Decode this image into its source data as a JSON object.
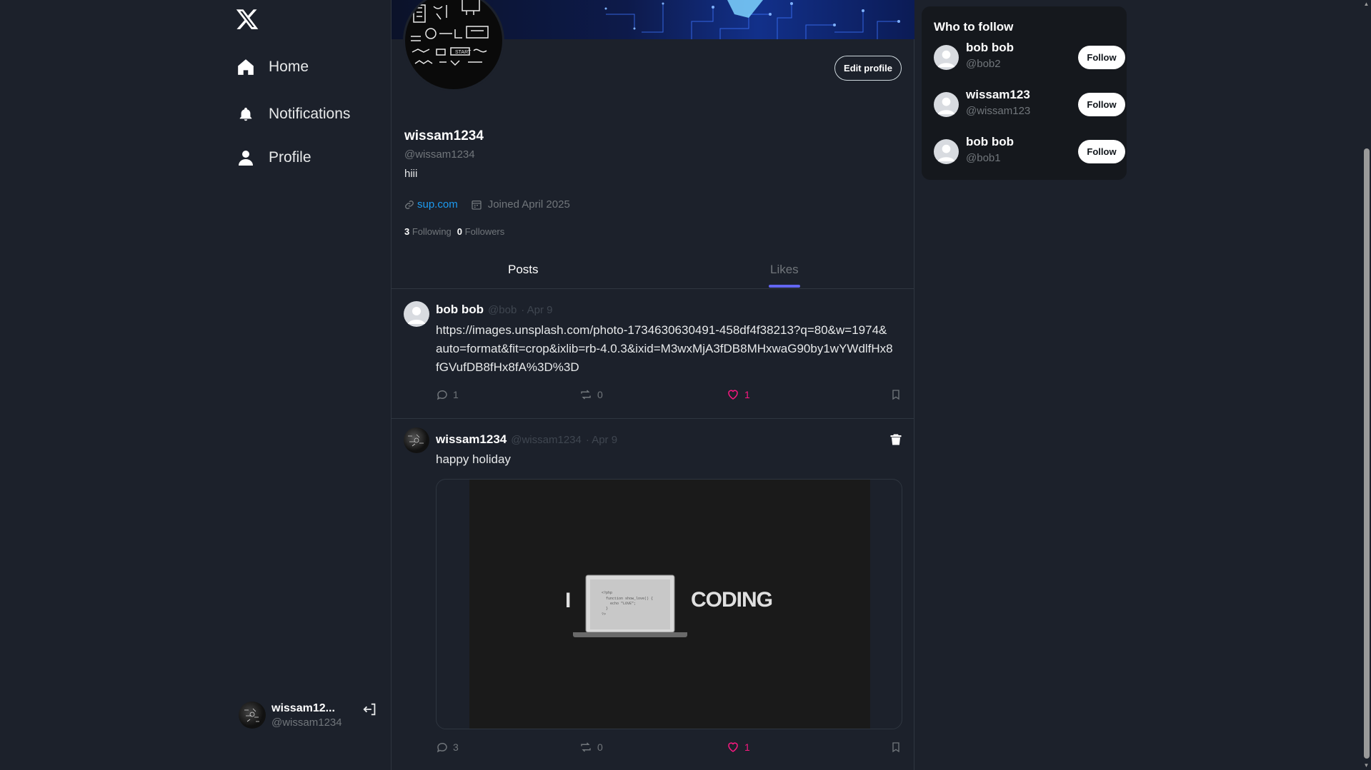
{
  "app": {
    "logo": "x-logo-icon"
  },
  "nav": {
    "items": [
      {
        "label": "Home",
        "icon": "home-icon"
      },
      {
        "label": "Notifications",
        "icon": "bell-icon"
      },
      {
        "label": "Profile",
        "icon": "user-icon"
      }
    ]
  },
  "account": {
    "display_name": "wissam12...",
    "handle": "@wissam1234"
  },
  "profile": {
    "name": "wissam1234",
    "handle": "@wissam1234",
    "bio": "hiii",
    "website": "sup.com",
    "joined": "Joined April 2025",
    "following_count": "3",
    "following_label": "Following",
    "followers_count": "0",
    "followers_label": "Followers",
    "edit_label": "Edit profile"
  },
  "tabs": [
    {
      "label": "Posts"
    },
    {
      "label": "Likes"
    }
  ],
  "posts": [
    {
      "name": "bob bob",
      "handle": "@bob",
      "date": "· Apr 9",
      "text": "https://images.unsplash.com/photo-1734630630491-458df4f38213?q=80&w=1974&auto=format&fit=crop&ixlib=rb-4.0.3&ixid=M3wxMjA3fDB8MHxwaG90by1wYWdlfHx8fGVufDB8fHx8fA%3D%3D",
      "replies": "1",
      "reposts": "0",
      "likes": "1"
    },
    {
      "name": "wissam1234",
      "handle": "@wissam1234",
      "date": "· Apr 9",
      "text": "happy holiday",
      "media_left": "I",
      "media_right": "CODING",
      "replies": "3",
      "reposts": "0",
      "likes": "1"
    }
  ],
  "who_to_follow": {
    "title": "Who to follow",
    "users": [
      {
        "name": "bob bob",
        "handle": "@bob2",
        "button": "Follow"
      },
      {
        "name": "wissam123",
        "handle": "@wissam123",
        "button": "Follow"
      },
      {
        "name": "bob bob",
        "handle": "@bob1",
        "button": "Follow"
      }
    ]
  },
  "colors": {
    "background": "#1c212b",
    "accent": "#6366f1",
    "like": "#f91880",
    "link": "#1d9bf0"
  }
}
